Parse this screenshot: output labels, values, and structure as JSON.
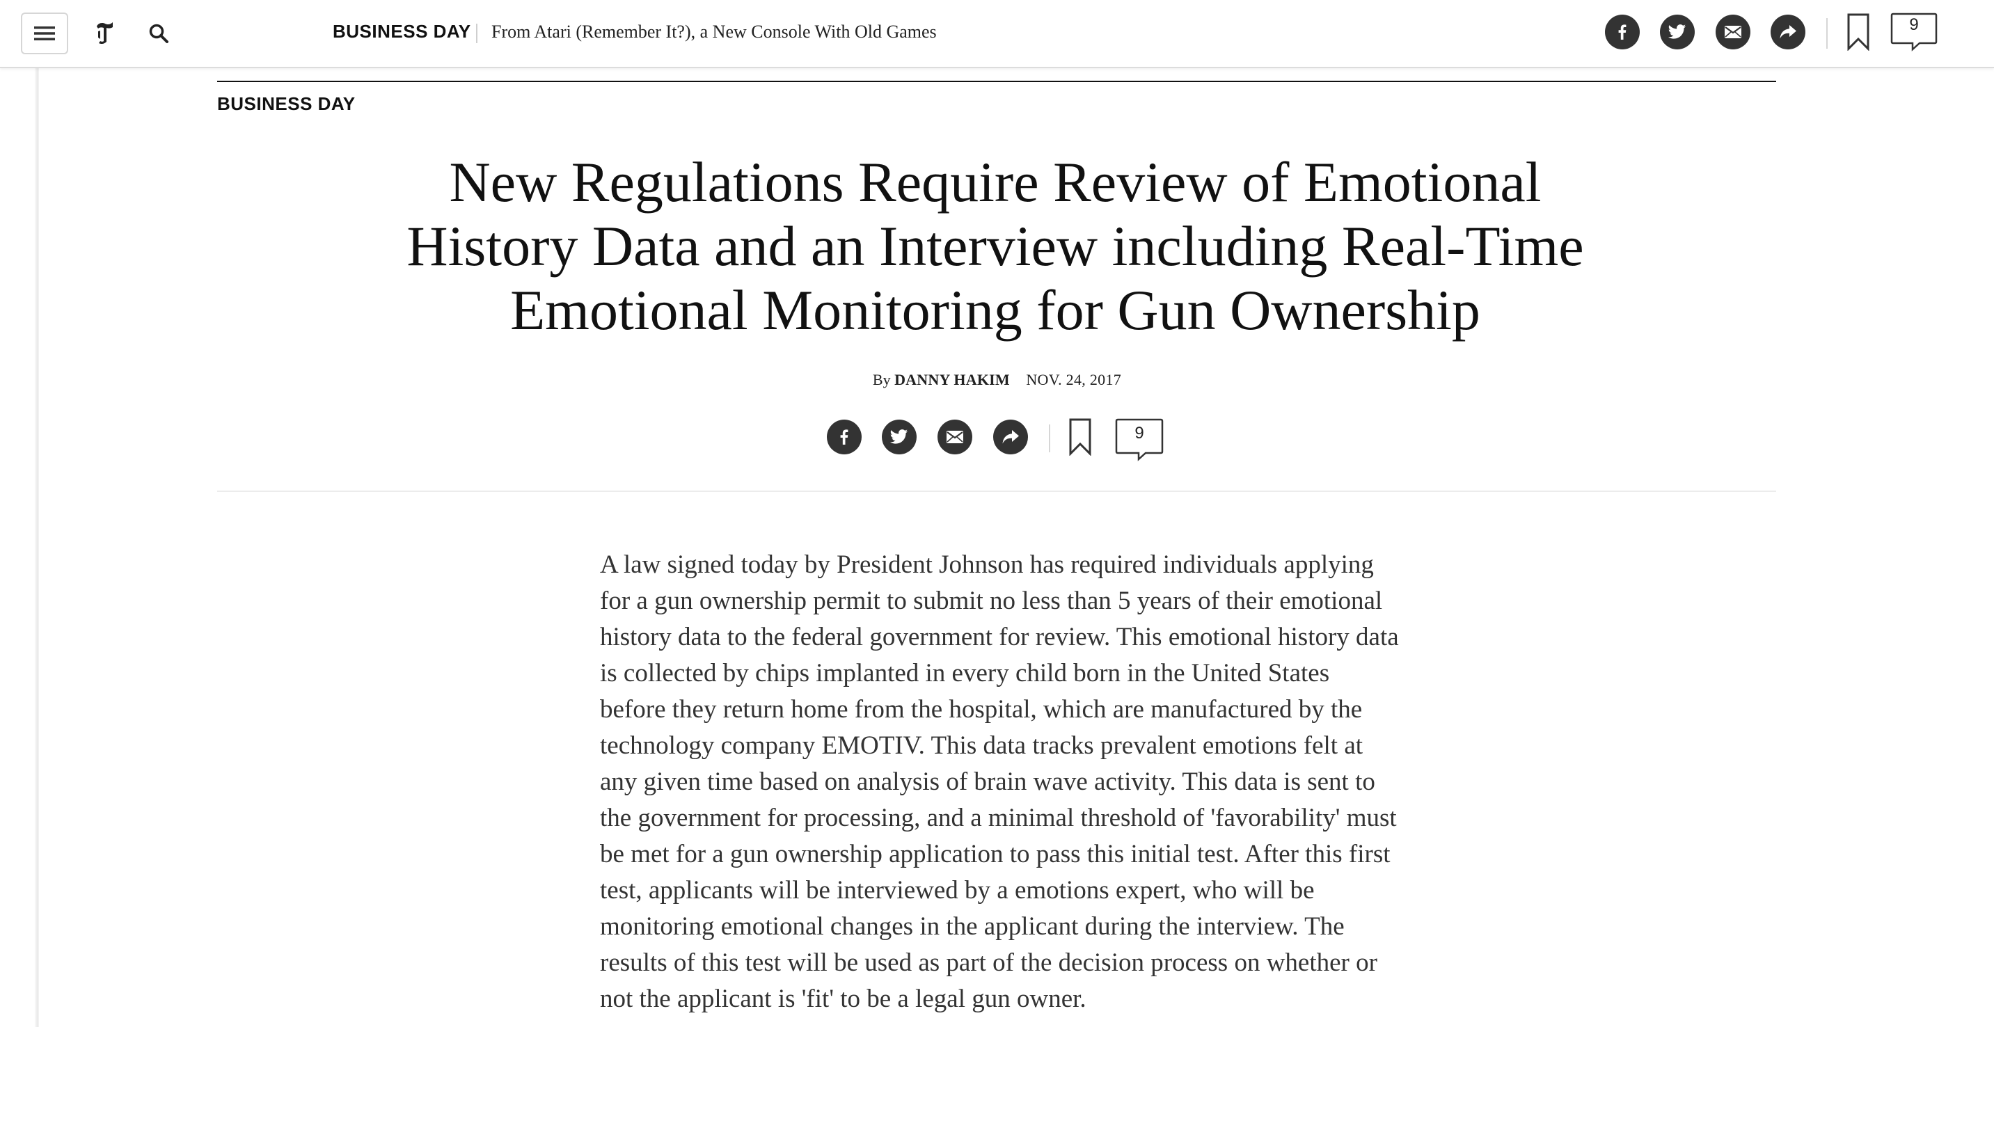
{
  "masthead": {
    "menu_icon": "hamburger-menu-icon",
    "logo_icon": "nyt-t-logo-icon",
    "search_icon": "search-icon",
    "section_label": "BUSINESS DAY",
    "headline": "From Atari (Remember It?), a New Console With Old Games",
    "share_icons": [
      "facebook-icon",
      "twitter-icon",
      "email-icon",
      "share-arrow-icon"
    ],
    "comment_count": "9"
  },
  "article": {
    "kicker": "BUSINESS DAY",
    "headline": "New Regulations Require Review of Emotional History Data and an Interview including Real-Time Emotional Monitoring for Gun Ownership",
    "byline_prefix": "By",
    "author": "DANNY HAKIM",
    "date": "NOV. 24, 2017",
    "comment_count": "9",
    "body": "A law signed today by President Johnson has required individuals applying for a gun ownership permit to submit no less than 5 years of their emotional history data to the federal government for review. This emotional history data is collected by chips implanted in every child born in the United States before they return home from the hospital, which are manufactured by the technology company EMOTIV. This data tracks prevalent emotions felt at any given time based on analysis of brain wave activity. This data is sent to the government for processing, and a minimal threshold of 'favorability' must be met for a gun ownership application to pass this initial test. After this first test, applicants will be interviewed by a emotions expert, who will be monitoring emotional changes in the applicant during the interview. The results of this test will be used as part of the decision process on whether or not the applicant is 'fit' to be a legal gun owner."
  },
  "colors": {
    "icon_fill": "#333333",
    "text_primary": "#111111",
    "body_text": "#333333",
    "rule": "#111111",
    "light_rule": "#ececec"
  }
}
